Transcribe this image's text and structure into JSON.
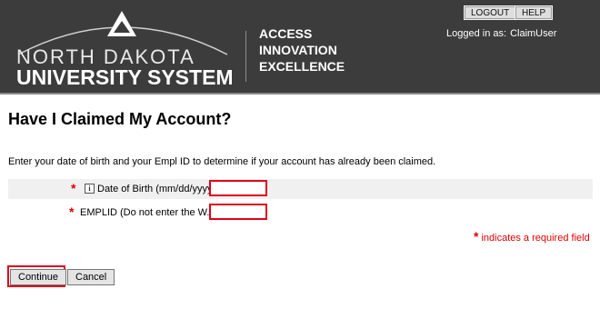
{
  "header": {
    "logo": {
      "line1": "NORTH DAKOTA",
      "line2": "UNIVERSITY SYSTEM"
    },
    "tagline": [
      "ACCESS",
      "INNOVATION",
      "EXCELLENCE"
    ],
    "buttons": {
      "logout": "LOGOUT",
      "help": "HELP"
    },
    "logged_in_label": "Logged in as:",
    "logged_in_user": "ClaimUser"
  },
  "main": {
    "title": "Have I Claimed My Account?",
    "instructions": "Enter your date of birth and your Empl ID to determine if your account has already been claimed.",
    "fields": {
      "dob": {
        "required_mark": "*",
        "info_icon": "i",
        "label": "Date of Birth (mm/dd/yyyy)",
        "value": ""
      },
      "emplid": {
        "required_mark": "*",
        "label": "EMPLID (Do not enter the W.)",
        "value": ""
      }
    },
    "required_note": {
      "mark": "*",
      "text": "indicates a required field"
    },
    "buttons": {
      "continue": "Continue",
      "cancel": "Cancel"
    }
  },
  "colors": {
    "header_bg": "#3c3c3c",
    "required_red": "#dd0000",
    "highlight_red": "#e0001a",
    "row_alt": "#f0f0f0"
  },
  "icons": {
    "logo": "ndus-logo-icon",
    "info": "info-icon"
  }
}
